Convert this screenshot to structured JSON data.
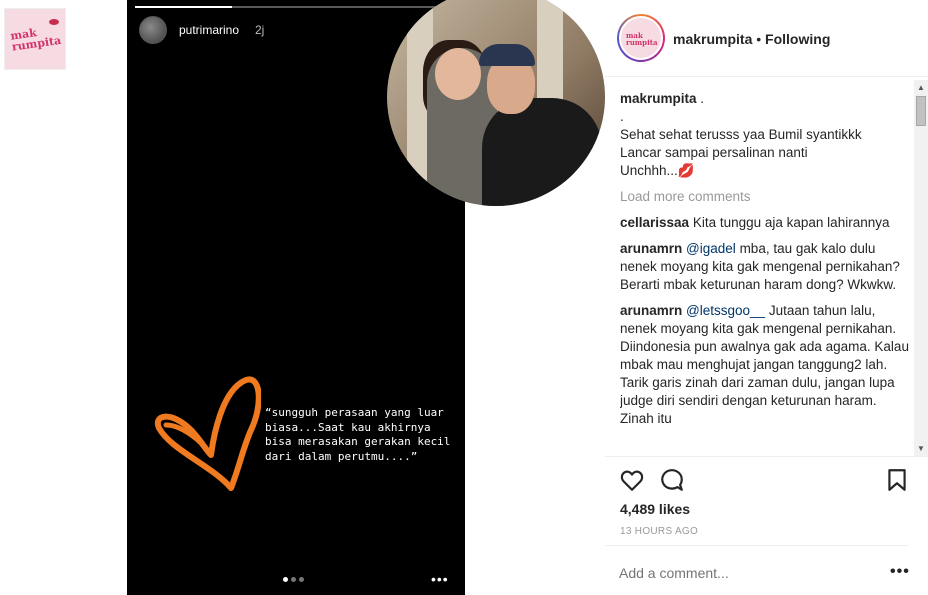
{
  "side_thumbnail": {
    "text": "mak rumpita"
  },
  "story": {
    "username": "putrimarino",
    "time": "2j",
    "progress": 0.3,
    "quote": "“sungguh perasaan yang luar biasa...Saat kau akhirnya bisa merasakan gerakan kecil dari dalam perutmu....”",
    "more_label": "•••"
  },
  "post": {
    "account": "makrumpita",
    "separator": "•",
    "follow_status": "Following",
    "caption_user": "makrumpita",
    "caption_lines": [
      ".",
      ".",
      "Sehat sehat terusss yaa Bumil syantikkk",
      "Lancar sampai persalinan nanti",
      "Unchhh...💋"
    ],
    "load_more": "Load more comments",
    "comments": [
      {
        "user": "cellarissaa",
        "mention": "",
        "text": "Kita tunggu aja kapan lahirannya"
      },
      {
        "user": "arunamrn",
        "mention": "@igadel",
        "text": "mba, tau gak kalo dulu nenek moyang kita gak mengenal pernikahan? Berarti mbak keturunan haram dong? Wkwkw."
      },
      {
        "user": "arunamrn",
        "mention": "@letssgoo__",
        "text": "Jutaan tahun lalu, nenek moyang kita gak mengenal pernikahan. Diindonesia pun awalnya gak ada agama. Kalau mbak mau menghujat jangan tanggung2 lah. Tarik garis zinah dari zaman dulu, jangan lupa judge diri sendiri dengan keturunan haram. Zinah itu"
      }
    ],
    "likes": "4,489 likes",
    "timestamp": "13 HOURS AGO",
    "add_comment_placeholder": "Add a comment...",
    "options_label": "•••"
  }
}
